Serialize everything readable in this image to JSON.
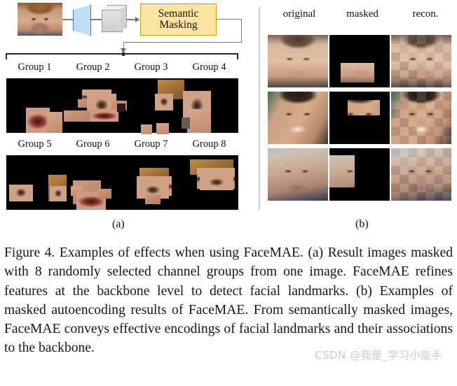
{
  "figure": {
    "panel_a": {
      "sublabel": "(a)",
      "pipeline": {
        "input_image_alt": "face-photo",
        "encoder_alt": "trapezoid-encoder",
        "feature_alt": "feature-cube",
        "module_label": "Semantic\nMasking",
        "module_label_line1": "Semantic",
        "module_label_line2": "Masking",
        "module_fill": "#fbe3a0",
        "module_border": "#d49c10",
        "encoder_fill": "#bfdff5",
        "encoder_border": "#3f78c8",
        "wire_color": "#7c7c7c"
      },
      "group_labels_row1": [
        "Group 1",
        "Group 2",
        "Group 3",
        "Group 4"
      ],
      "group_labels_row2": [
        "Group 5",
        "Group 6",
        "Group 7",
        "Group 8"
      ],
      "strip_background": "#000000"
    },
    "panel_b": {
      "sublabel": "(b)",
      "column_headers": [
        "original",
        "masked",
        "recon."
      ],
      "rows": [
        {
          "row_label": "row-1",
          "cells": [
            "original",
            "masked",
            "recon."
          ]
        },
        {
          "row_label": "row-2",
          "cells": [
            "original",
            "masked",
            "recon."
          ]
        },
        {
          "row_label": "row-3",
          "cells": [
            "original",
            "masked",
            "recon."
          ]
        }
      ],
      "mask_color": "#000000"
    },
    "divider_color": "#cfcfcf"
  },
  "caption": {
    "text": "Figure 4. Examples of effects when using FaceMAE. (a) Result images masked with 8 randomly selected channel groups from one image. FaceMAE refines features at the backbone level to detect facial landmarks. (b) Examples of masked autoencoding results of FaceMAE. From semantically masked images, FaceMAE conveys effective encodings of facial landmarks and their associations to the backbone."
  },
  "watermark": {
    "text": "CSDN @我是_学习小能手",
    "color": "#c9c9c9"
  }
}
